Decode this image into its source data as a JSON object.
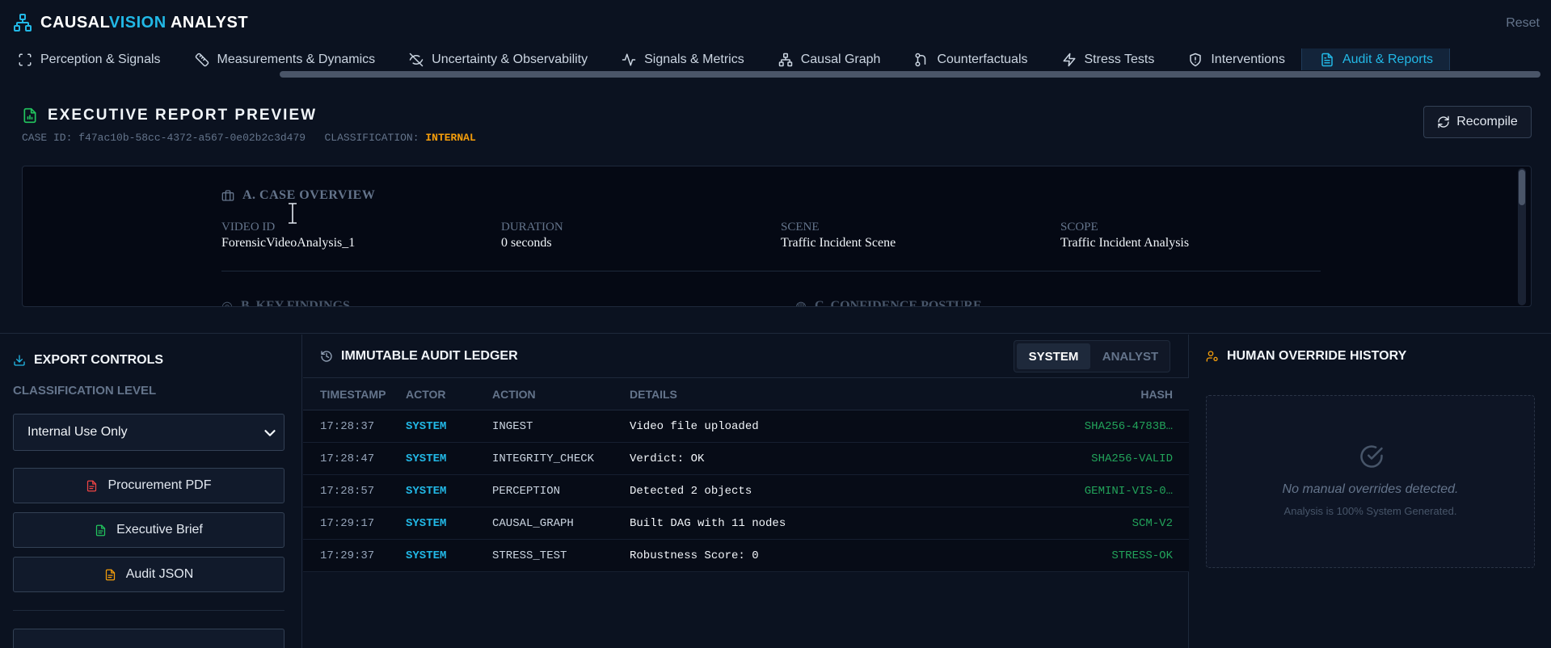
{
  "app": {
    "brand_part1": "CAUSAL",
    "brand_part2": "VISION",
    "brand_part3": " ANALYST",
    "reset_label": "Reset",
    "accent_color": "#22b8e6"
  },
  "nav": {
    "tabs": [
      {
        "label": "Perception & Signals",
        "icon": "focus-frame-icon"
      },
      {
        "label": "Measurements & Dynamics",
        "icon": "ruler-icon"
      },
      {
        "label": "Uncertainty & Observability",
        "icon": "eye-off-icon"
      },
      {
        "label": "Signals & Metrics",
        "icon": "activity-icon"
      },
      {
        "label": "Causal Graph",
        "icon": "network-icon"
      },
      {
        "label": "Counterfactuals",
        "icon": "branch-icon"
      },
      {
        "label": "Stress Tests",
        "icon": "bolt-icon"
      },
      {
        "label": "Interventions",
        "icon": "shield-icon"
      },
      {
        "label": "Audit & Reports",
        "icon": "document-icon",
        "active": true
      }
    ]
  },
  "report": {
    "title": "EXECUTIVE REPORT PREVIEW",
    "case_id_label": "CASE ID:",
    "case_id": "f47ac10b-58cc-4372-a567-0e02b2c3d479",
    "classification_label": "CLASSIFICATION:",
    "classification": "INTERNAL",
    "recompile_label": "Recompile",
    "overview": {
      "heading": "A. CASE OVERVIEW",
      "fields": [
        {
          "label": "VIDEO ID",
          "value": "ForensicVideoAnalysis_1"
        },
        {
          "label": "DURATION",
          "value": "0 seconds"
        },
        {
          "label": "SCENE",
          "value": "Traffic Incident Scene"
        },
        {
          "label": "SCOPE",
          "value": "Traffic Incident Analysis"
        }
      ]
    },
    "key_findings_heading": "B. KEY FINDINGS",
    "confidence_heading": "C. CONFIDENCE POSTURE"
  },
  "export": {
    "heading": "EXPORT CONTROLS",
    "classification_label": "CLASSIFICATION LEVEL",
    "classification_value": "Internal Use Only",
    "buttons": [
      {
        "label": "Procurement PDF",
        "icon": "pdf-file-icon",
        "color": "#ef4444"
      },
      {
        "label": "Executive Brief",
        "icon": "brief-file-icon",
        "color": "#22c55e"
      },
      {
        "label": "Audit JSON",
        "icon": "json-file-icon",
        "color": "#f59e0b"
      }
    ]
  },
  "ledger": {
    "heading": "IMMUTABLE AUDIT LEDGER",
    "filters": [
      "SYSTEM",
      "ANALYST"
    ],
    "active_filter": "SYSTEM",
    "columns": [
      "TIMESTAMP",
      "ACTOR",
      "ACTION",
      "DETAILS",
      "HASH"
    ],
    "rows": [
      {
        "timestamp": "17:28:37",
        "actor": "SYSTEM",
        "action": "INGEST",
        "details": "Video file uploaded",
        "hash": "SHA256-4783B…"
      },
      {
        "timestamp": "17:28:47",
        "actor": "SYSTEM",
        "action": "INTEGRITY_CHECK",
        "details": "Verdict: OK",
        "hash": "SHA256-VALID"
      },
      {
        "timestamp": "17:28:57",
        "actor": "SYSTEM",
        "action": "PERCEPTION",
        "details": "Detected 2 objects",
        "hash": "GEMINI-VIS-0…"
      },
      {
        "timestamp": "17:29:17",
        "actor": "SYSTEM",
        "action": "CAUSAL_GRAPH",
        "details": "Built DAG with 11 nodes",
        "hash": "SCM-V2"
      },
      {
        "timestamp": "17:29:37",
        "actor": "SYSTEM",
        "action": "STRESS_TEST",
        "details": "Robustness Score: 0",
        "hash": "STRESS-OK"
      }
    ]
  },
  "overrides": {
    "heading": "HUMAN OVERRIDE HISTORY",
    "empty_title": "No manual overrides detected.",
    "empty_subtitle": "Analysis is 100% System Generated."
  }
}
